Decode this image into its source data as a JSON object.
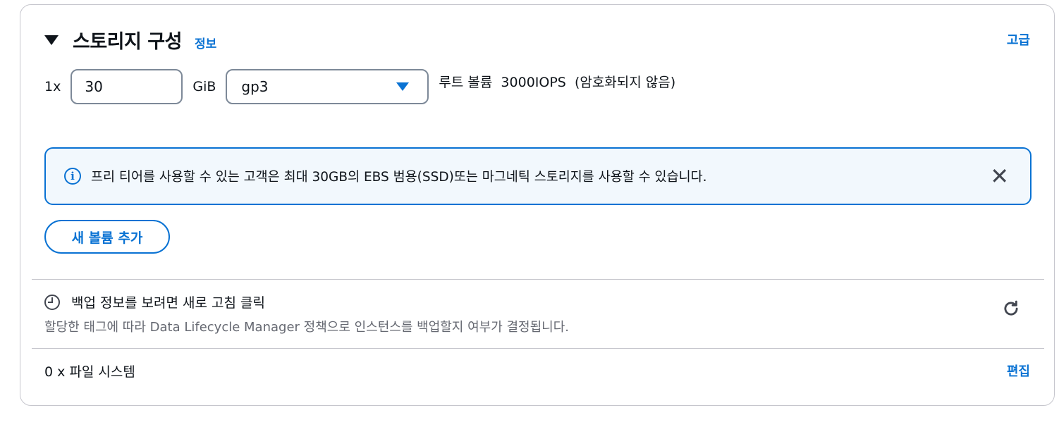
{
  "storage": {
    "title": "스토리지 구성",
    "info_link": "정보",
    "advanced_link": "고급"
  },
  "volume": {
    "multiplier": "1x",
    "size_value": "30",
    "unit": "GiB",
    "type_selected": "gp3",
    "description": "루트 볼륨  3000IOPS  (암호화되지 않음)"
  },
  "alert": {
    "icon": "info-icon",
    "text": "프리 티어를 사용할 수 있는 고객은 최대 30GB의 EBS 범용(SSD)또는 마그네틱 스토리지를 사용할 수 있습니다.",
    "close_glyph": "✕"
  },
  "add_volume_label": "새 볼륨 추가",
  "backup": {
    "title": "백업 정보를 보려면 새로 고침 클릭",
    "description": "할당한 태그에 따라 Data Lifecycle Manager 정책으로 인스턴스를 백업할지 여부가 결정됩니다."
  },
  "file_systems": {
    "label": "0 x 파일 시스템",
    "edit_link": "편집"
  },
  "colors": {
    "accent": "#0972d3",
    "alert_bg": "#f2f8fd",
    "border": "#c6c6cd",
    "muted_text": "#656871"
  }
}
